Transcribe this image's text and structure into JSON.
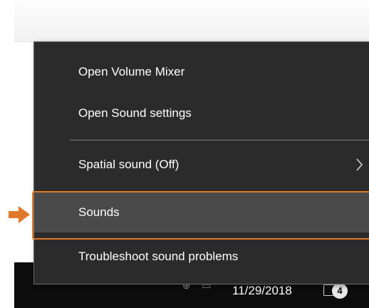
{
  "menu": {
    "items": [
      {
        "label": "Open Volume Mixer"
      },
      {
        "label": "Open Sound settings"
      },
      {
        "label": "Spatial sound (Off)",
        "submenu": true
      },
      {
        "label": "Sounds",
        "highlighted": true
      },
      {
        "label": "Troubleshoot sound problems"
      }
    ]
  },
  "taskbar": {
    "date": "11/29/2018",
    "notification_count": "4",
    "tray_icon_glyphs": "⌃ ⊕ ▭"
  },
  "annotation": {
    "highlight_color": "#e07a2a",
    "arrow_icon": "right-arrow-icon"
  },
  "colors": {
    "menu_background": "#2b2b2b",
    "menu_hover": "#4a4a4a",
    "taskbar": "#0c0c0c"
  }
}
